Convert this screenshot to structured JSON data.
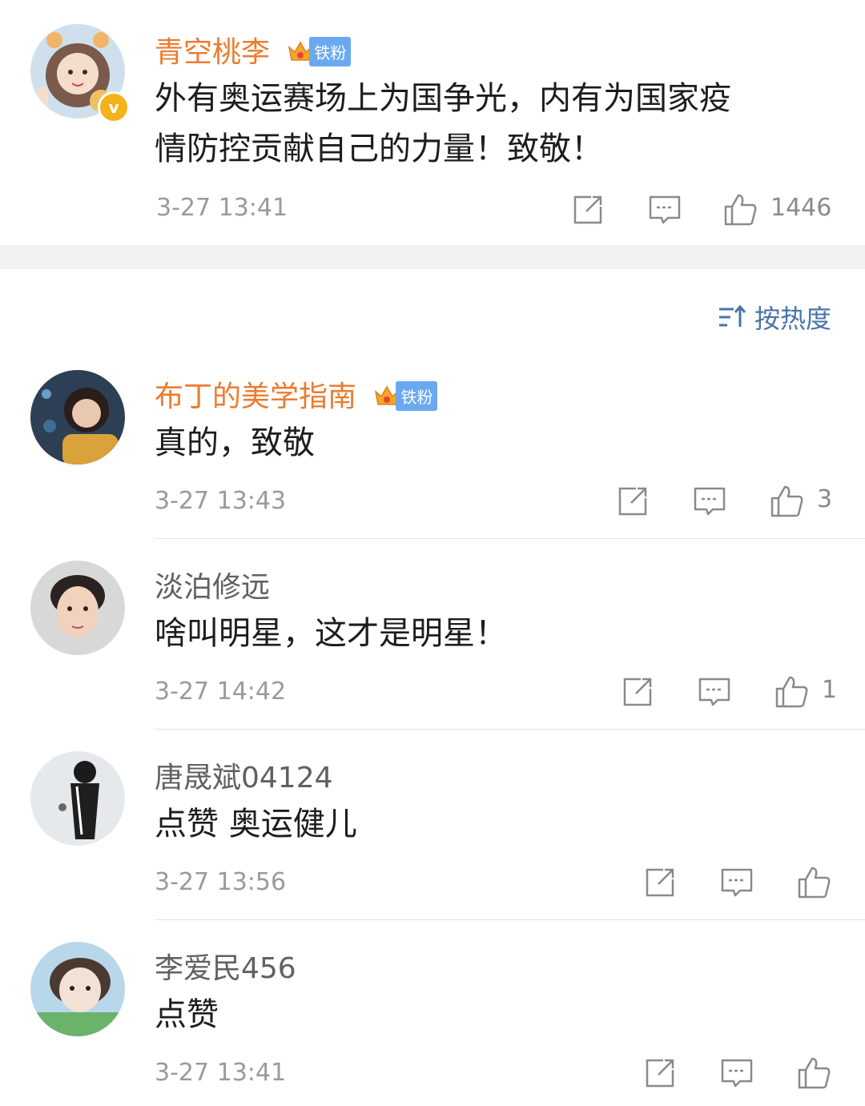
{
  "post": {
    "user": {
      "name": "青空桃李",
      "badge": "铁粉",
      "verified": "v"
    },
    "text_line1": "外有奥运赛场上为国争光，内有为国家疫",
    "text_line2": "情防控贡献自己的力量！致敬！",
    "time": "3-27 13:41",
    "likes": "1446"
  },
  "sort": {
    "label": "按热度"
  },
  "comments": [
    {
      "name": "布丁的美学指南",
      "badge": "铁粉",
      "text": "真的，致敬",
      "time": "3-27 13:43",
      "likes": "3"
    },
    {
      "name": "淡泊修远",
      "text": "啥叫明星，这才是明星！",
      "time": "3-27 14:42",
      "likes": "1"
    },
    {
      "name": "唐晟斌04124",
      "text": "点赞 奥运健儿",
      "time": "3-27 13:56",
      "likes": ""
    },
    {
      "name": "李爱民456",
      "text": "点赞",
      "time": "3-27 13:41",
      "likes": ""
    }
  ],
  "colors": {
    "name_orange": "#ed7b2f",
    "link_blue": "#4a74a8",
    "badge_blue": "#6aa9ef",
    "vip_gold": "#f6b21a"
  }
}
